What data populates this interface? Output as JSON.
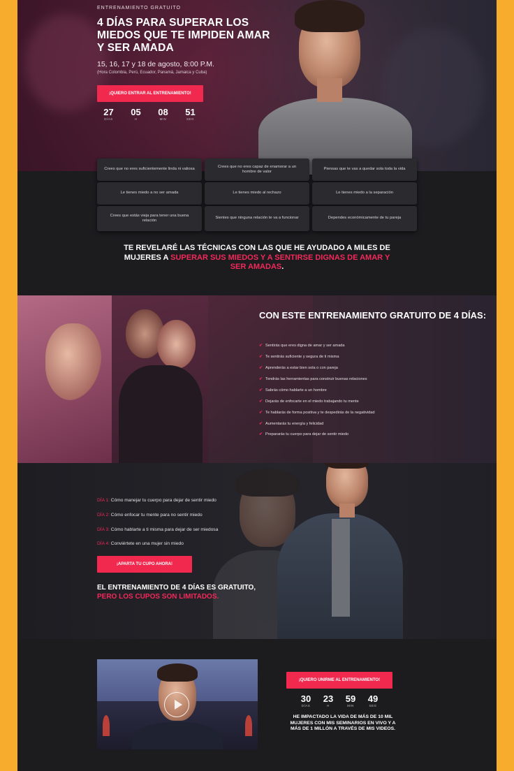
{
  "hero": {
    "eyebrow": "ENTRENAMIENTO GRATUITO",
    "title": "4 DÍAS PARA SUPERAR LOS MIEDOS QUE TE IMPIDEN AMAR Y SER AMADA",
    "date": "15, 16, 17 y 18 de agosto, 8:00 P.M.",
    "timezone_note": "(Hora Colombia, Perú, Ecuador, Panamá, Jamaica y Cuba)",
    "cta": "¡QUIERO ENTRAR AL ENTRENAMIENTO!",
    "countdown": [
      {
        "value": "27",
        "label": "DÍAS"
      },
      {
        "value": "05",
        "label": "H"
      },
      {
        "value": "08",
        "label": "MIN"
      },
      {
        "value": "51",
        "label": "SEG"
      }
    ]
  },
  "fears": [
    "Crees que no eres suficientemente linda ni valiosa",
    "Crees que no eres capaz de enamorar a un hombre de valor",
    "Piensas que te vas a quedar sola toda la vida",
    "Le tienes miedo a no ser amada",
    "Le tienes miedo al rechazo",
    "Le tienes miedo a la separación",
    "Crees que estás vieja para tener una buena relación",
    "Sientes que ninguna relación te va a funcionar",
    "Dependes económicamente de tu pareja"
  ],
  "reveal": {
    "part1": "TE REVELARÉ LAS TÉCNICAS CON LAS QUE HE AYUDADO A MILES DE MUJERES A ",
    "highlight": "SUPERAR SUS MIEDOS Y A SENTIRSE DIGNAS DE AMAR Y SER AMADAS",
    "part2": "."
  },
  "benefits": {
    "title": "CON ESTE ENTRENAMIENTO GRATUITO DE 4 DÍAS:",
    "items": [
      "Sentirás que eres digna de amar y ser amada",
      "Te sentirás suficiente y segura de ti misma",
      "Aprenderás a estar bien sola o con pareja",
      "Tendrás las herramientas para construir buenas relaciones",
      "Sabrás cómo hablarte a un hombre",
      "Dejarás de enfocarte en el miedo trabajando tu mente",
      "Te hablarás de forma positiva y te despedirás de la negatividad",
      "Aumentarás tu energía y felicidad",
      "Prepararás tu cuerpo para dejar de sentir miedo"
    ]
  },
  "days": {
    "items": [
      {
        "label": "DÍA 1:",
        "text": " Cómo manejar tu cuerpo para dejar de sentir miedo"
      },
      {
        "label": "DÍA 2:",
        "text": " Cómo enfocar tu mente para no sentir miedo"
      },
      {
        "label": "DÍA 3:",
        "text": " Cómo hablarte a ti misma para dejar de ser miedosa"
      },
      {
        "label": "DÍA 4:",
        "text": " Conviértete en una mujer sin miedo"
      }
    ],
    "cta": "¡APARTA TU CUPO AHORA!",
    "limited_line1": "EL ENTRENAMIENTO DE 4 DÍAS ES GRATUITO,",
    "limited_line2": "PERO LOS CUPOS SON LIMITADOS."
  },
  "footer": {
    "cta": "¡QUIERO UNIRME AL ENTRENAMIENTO!",
    "countdown": [
      {
        "value": "30",
        "label": "DÍAS"
      },
      {
        "value": "23",
        "label": "H"
      },
      {
        "value": "59",
        "label": "MIN"
      },
      {
        "value": "49",
        "label": "SEG"
      }
    ],
    "impact": "HE IMPACTADO LA VIDA DE MÁS DE 10 MIL MUJERES CON MIS SEMINARIOS EN VIVO Y A MÁS DE 1 MILLÓN A TRAVÉS DE MIS VIDEOS."
  },
  "colors": {
    "accent": "#f2294f",
    "frame": "#f7ac2e",
    "background": "#1c1c1f"
  }
}
